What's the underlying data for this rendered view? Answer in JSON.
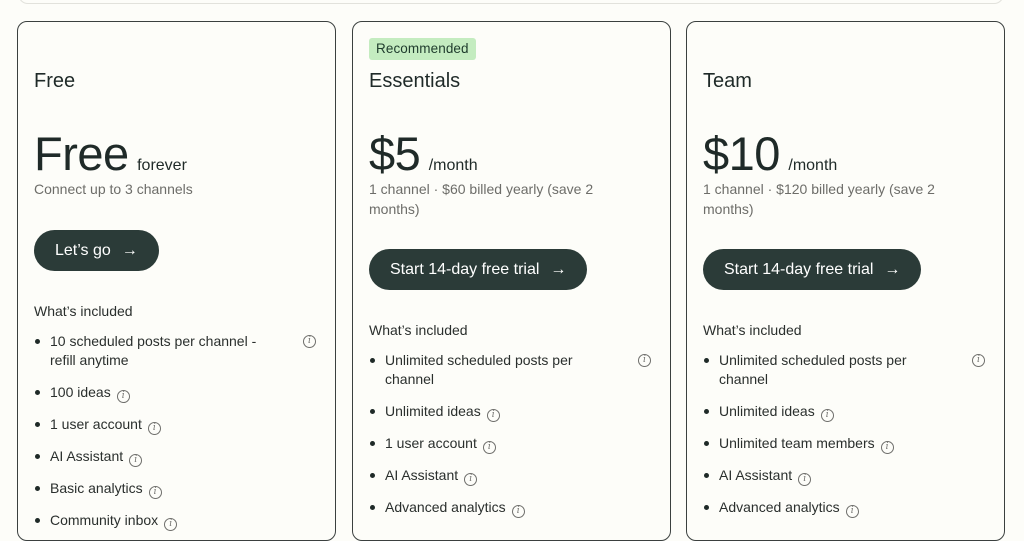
{
  "plans": [
    {
      "badge": "",
      "name": "Free",
      "price": "Free",
      "period": "forever",
      "subtitle": "Connect up to 3 channels",
      "cta": "Let’s go",
      "included_title": "What’s included",
      "features": [
        "10 scheduled posts per channel - refill anytime",
        "100 ideas",
        "1 user account",
        "AI Assistant",
        "Basic analytics",
        "Community inbox"
      ]
    },
    {
      "badge": "Recommended",
      "name": "Essentials",
      "price": "$5",
      "period": "/month",
      "subtitle": "1 channel · $60 billed yearly (save 2 months)",
      "cta": "Start 14-day free trial",
      "included_title": "What’s included",
      "features": [
        "Unlimited scheduled posts per channel",
        "Unlimited ideas",
        "1 user account",
        "AI Assistant",
        "Advanced analytics"
      ]
    },
    {
      "badge": "",
      "name": "Team",
      "price": "$10",
      "period": "/month",
      "subtitle": "1 channel · $120 billed yearly (save 2 months)",
      "cta": "Start 14-day free trial",
      "included_title": "What’s included",
      "features": [
        "Unlimited scheduled posts per channel",
        "Unlimited ideas",
        "Unlimited team members",
        "AI Assistant",
        "Advanced analytics"
      ]
    }
  ],
  "icons": {
    "cta_arrow": "arrow-right-icon",
    "feature_info": "info-circle-icon"
  },
  "colors": {
    "button": "#2b3b38",
    "badge_bg": "#c4ecc0",
    "card_border": "#3b403f",
    "background": "#fdfdf9"
  }
}
